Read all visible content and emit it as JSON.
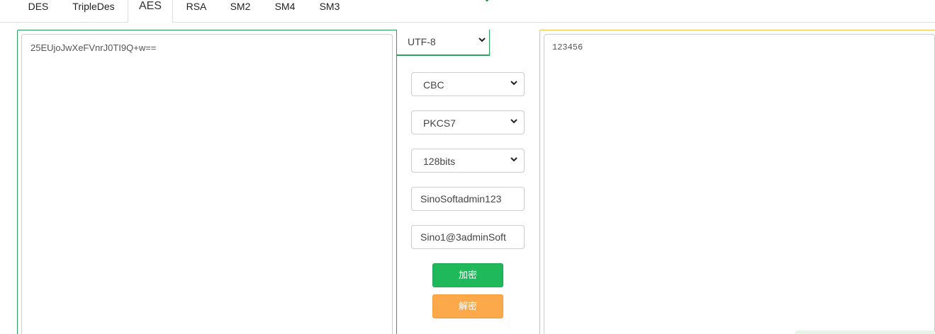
{
  "tabs": [
    {
      "label": "DES"
    },
    {
      "label": "TripleDes"
    },
    {
      "label": "AES"
    },
    {
      "label": "RSA"
    },
    {
      "label": "SM2"
    },
    {
      "label": "SM4"
    },
    {
      "label": "SM3"
    }
  ],
  "active_tab": "AES",
  "left": {
    "input_value": "25EUjoJwXeFVnrJ0TI9Q+w=="
  },
  "controls": {
    "charset": "UTF-8",
    "mode": "CBC",
    "padding": "PKCS7",
    "key_size": "128bits",
    "key": "SinoSoftadmin123",
    "iv": "Sino1@3adminSoft",
    "encrypt_label": "加密",
    "decrypt_label": "解密"
  },
  "right": {
    "output_value": "123456"
  },
  "colors": {
    "left_border": "#29a35a",
    "right_border": "#f0c24e",
    "encrypt_button": "#1fb85a",
    "decrypt_button": "#fba94a"
  },
  "icons": {
    "select_caret": "chevron-down-icon"
  }
}
